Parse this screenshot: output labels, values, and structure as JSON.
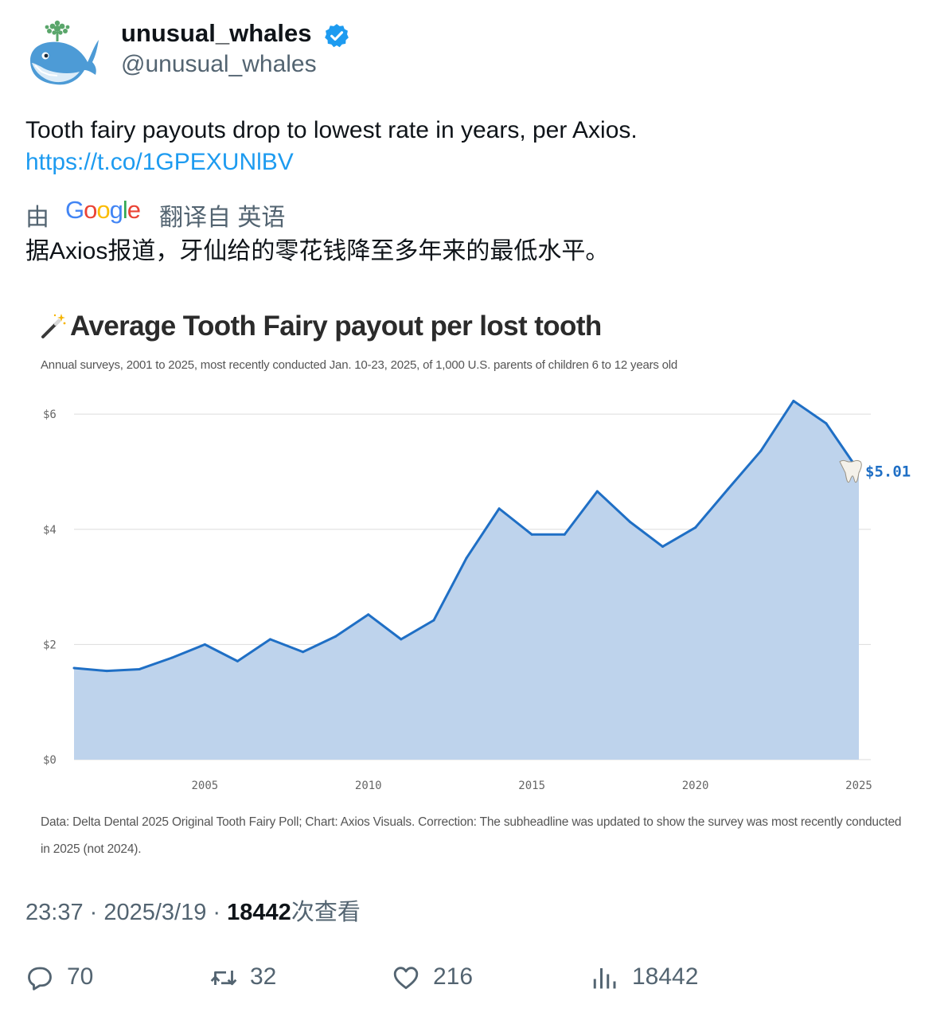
{
  "author": {
    "display_name": "unusual_whales",
    "handle": "@unusual_whales"
  },
  "tweet": {
    "text": "Tooth fairy payouts drop to lowest rate in years, per Axios.",
    "link": "https://t.co/1GPEXUNlBV"
  },
  "translation": {
    "by_label": "由",
    "logo_text": "Google",
    "from_label": "翻译自 英语",
    "text": "据Axios报道，牙仙给的零花钱降至多年来的最低水平。"
  },
  "chart_data": {
    "type": "area",
    "title": "Average Tooth Fairy payout per lost tooth",
    "subtitle": "Annual surveys, 2001 to 2025, most recently conducted Jan. 10-23, 2025, of 1,000 U.S. parents of children 6 to 12 years old",
    "x": [
      2001,
      2002,
      2003,
      2004,
      2005,
      2006,
      2007,
      2008,
      2009,
      2010,
      2011,
      2012,
      2013,
      2014,
      2015,
      2016,
      2017,
      2018,
      2019,
      2020,
      2021,
      2022,
      2023,
      2024,
      2025
    ],
    "values": [
      1.59,
      1.54,
      1.57,
      1.77,
      2.0,
      1.71,
      2.09,
      1.87,
      2.14,
      2.52,
      2.09,
      2.42,
      3.5,
      4.36,
      3.91,
      3.91,
      4.66,
      4.13,
      3.7,
      4.03,
      4.7,
      5.36,
      6.23,
      5.84,
      5.01
    ],
    "xticks": [
      "2005",
      "2010",
      "2015",
      "2020",
      "2025"
    ],
    "xtick_values": [
      2005,
      2010,
      2015,
      2020,
      2025
    ],
    "yticks": [
      "$0",
      "$2",
      "$4",
      "$6"
    ],
    "ytick_values": [
      0,
      2,
      4,
      6
    ],
    "ylim": [
      0,
      6.5
    ],
    "xlim": [
      2001,
      2025
    ],
    "end_label": "$5.01",
    "source": "Data: Delta Dental 2025 Original Tooth Fairy Poll; Chart: Axios Visuals. Correction: The subheadline was updated to show the survey was most recently conducted in 2025 (not 2024).",
    "line_color": "#1f6fc5",
    "fill_color": "#bed3ec",
    "grid": true
  },
  "meta": {
    "time": "23:37",
    "date": "2025/3/19",
    "views": "18442",
    "views_label": "次查看"
  },
  "actions": {
    "replies": "70",
    "retweets": "32",
    "likes": "216",
    "views": "18442"
  },
  "colors": {
    "link": "#1d9bf0",
    "secondary_text": "#536471",
    "verified": "#1d9bf0"
  }
}
